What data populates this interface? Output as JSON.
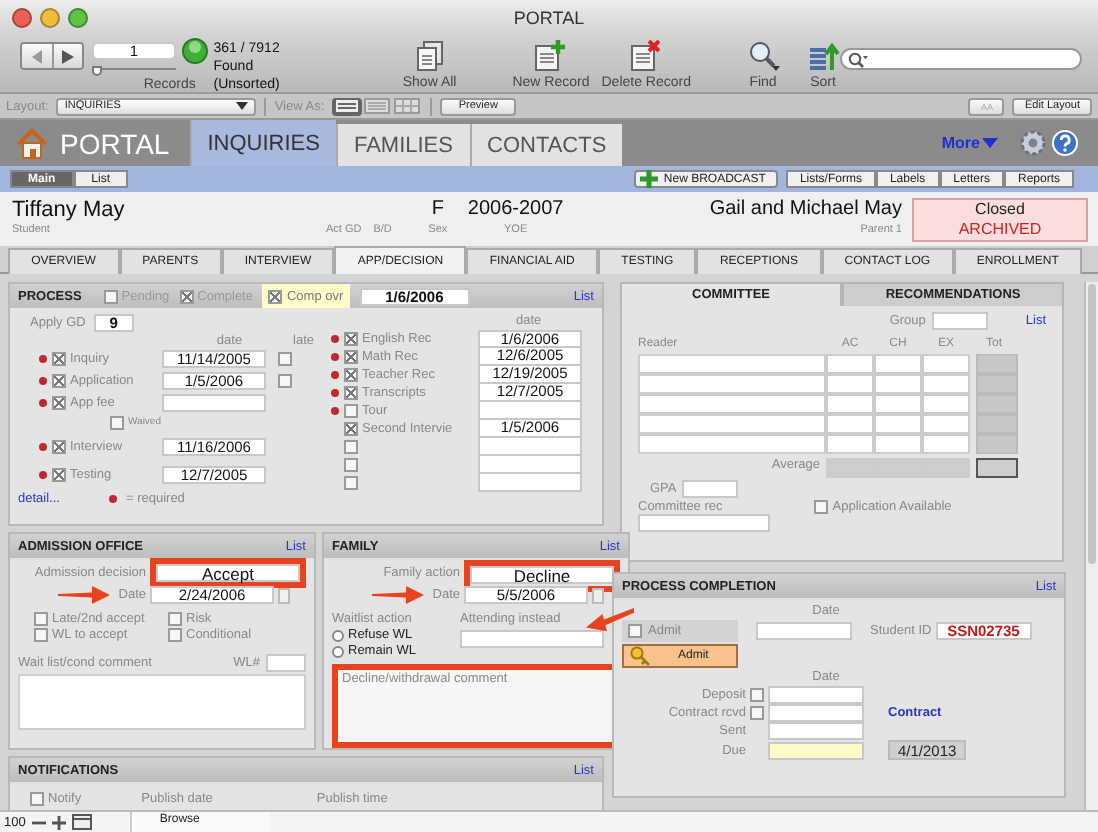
{
  "window": {
    "title": "PORTAL"
  },
  "toolbar": {
    "record_number": "1",
    "record_slider": {
      "level": 0
    },
    "record_count": "361 / 7912",
    "found_status": "Found (Unsorted)",
    "records_label": "Records",
    "actions": [
      {
        "kind": "show_all",
        "label": "Show All"
      },
      {
        "kind": "new",
        "label": "New Record"
      },
      {
        "kind": "delete",
        "label": "Delete Record"
      },
      {
        "kind": "find",
        "label": "Find"
      },
      {
        "kind": "sort",
        "label": "Sort"
      }
    ]
  },
  "layout_bar": {
    "layout_label": "Layout:",
    "layout": "INQUIRIES",
    "view_as_label": "View As:",
    "view_modes": [
      {
        "kind": "form",
        "selected": true
      },
      {
        "kind": "list",
        "selected": false
      },
      {
        "kind": "table",
        "selected": false
      }
    ],
    "preview": "Preview",
    "text_size": "AA",
    "edit_layout": "Edit Layout"
  },
  "app_header": {
    "logo": "PORTAL",
    "tabs": [
      {
        "label": "INQUIRIES",
        "selected": true
      },
      {
        "label": "FAMILIES",
        "selected": false
      },
      {
        "label": "CONTACTS",
        "selected": false
      }
    ],
    "more": "More"
  },
  "sub_bar": {
    "views": [
      {
        "label": "Main",
        "selected": true
      },
      {
        "label": "List",
        "selected": false
      }
    ],
    "broadcast": "New BROADCAST",
    "buttons": [
      "Lists/Forms",
      "Labels",
      "Letters",
      "Reports"
    ]
  },
  "student": {
    "name": "Tiffany May",
    "name_label": "Student",
    "act_gd_label": "Act GD",
    "bd_label": "B/D",
    "sex": "F",
    "sex_label": "Sex",
    "yoe": "2006-2007",
    "yoe_label": "YOE",
    "parent": "Gail and Michael May",
    "parent_label": "Parent 1",
    "status": "Closed",
    "archive": "ARCHIVED"
  },
  "record_tabs": [
    {
      "label": "OVERVIEW",
      "selected": false
    },
    {
      "label": "PARENTS",
      "selected": false
    },
    {
      "label": "INTERVIEW",
      "selected": false
    },
    {
      "label": "APP/DECISION",
      "selected": true
    },
    {
      "label": "FINANCIAL AID",
      "selected": false
    },
    {
      "label": "TESTING",
      "selected": false
    },
    {
      "label": "RECEPTIONS",
      "selected": false
    },
    {
      "label": "CONTACT LOG",
      "selected": false
    },
    {
      "label": "ENROLLMENT",
      "selected": false
    }
  ],
  "process": {
    "title": "PROCESS",
    "flags": [
      {
        "label": "Pending",
        "checked": false
      },
      {
        "label": "Complete",
        "checked": true
      }
    ],
    "override": {
      "label": "Comp ovr",
      "checked": true,
      "date": "1/6/2006"
    },
    "list_link": "List",
    "apply_gd_label": "Apply GD",
    "apply_gd": "9",
    "date_header": "date",
    "late_header": "late",
    "steps": [
      {
        "kind": "late",
        "label": "Inquiry",
        "required": true,
        "checked": true,
        "date": "11/14/2005",
        "late": false
      },
      {
        "kind": "late",
        "label": "Application",
        "required": true,
        "checked": true,
        "date": "1/5/2006",
        "late": false
      },
      {
        "kind": "fee",
        "label": "App fee",
        "required": true,
        "checked": true,
        "waived_label": "Waived",
        "waived": false
      },
      {
        "kind": "plain",
        "label": "Interview",
        "required": true,
        "checked": true,
        "date": "11/16/2006"
      },
      {
        "kind": "plain",
        "label": "Testing",
        "required": true,
        "checked": true,
        "date": "12/7/2005"
      }
    ],
    "rec_date_header": "date",
    "recs": [
      {
        "label": "English Rec",
        "required": true,
        "checked": true,
        "date": "1/6/2006"
      },
      {
        "label": "Math Rec",
        "required": true,
        "checked": true,
        "date": "12/6/2005"
      },
      {
        "label": "Teacher Rec",
        "required": true,
        "checked": true,
        "date": "12/19/2005"
      },
      {
        "label": "Transcripts",
        "required": true,
        "checked": true,
        "date": "12/7/2005"
      },
      {
        "label": "Tour",
        "required": true,
        "checked": false
      },
      {
        "label": "Second Intervie",
        "required": false,
        "checked": true,
        "date": "1/5/2006"
      },
      {
        "required": false,
        "checked": false
      },
      {
        "required": false,
        "checked": false
      },
      {
        "required": false,
        "checked": false
      }
    ],
    "detail_link": "detail...",
    "required_legend": "= required"
  },
  "committee": {
    "tabs": [
      {
        "label": "COMMITTEE",
        "selected": true
      },
      {
        "label": "RECOMMENDATIONS",
        "selected": false
      }
    ],
    "group_label": "Group",
    "list_link": "List",
    "columns": [
      "Reader",
      "AC",
      "CH",
      "EX",
      "Tot"
    ],
    "average_label": "Average",
    "gpa_label": "GPA",
    "committee_rec_label": "Committee rec",
    "application_available": {
      "label": "Application Available",
      "checked": false
    }
  },
  "admission_office": {
    "title": "ADMISSION OFFICE",
    "list_link": "List",
    "decision_label": "Admission decision",
    "decision": "Accept",
    "decision_highlighted": true,
    "date_label": "Date",
    "date": "2/24/2006",
    "date_arrow": true,
    "options": [
      {
        "label": "Late/2nd accept",
        "checked": false
      },
      {
        "label": "Risk",
        "checked": false
      },
      {
        "label": "WL to accept",
        "checked": false
      },
      {
        "label": "Conditional",
        "checked": false
      }
    ],
    "comment_label": "Wait list/cond comment",
    "wl_label": "WL#"
  },
  "family": {
    "title": "FAMILY",
    "list_link": "List",
    "action_label": "Family action",
    "action": "Decline",
    "action_highlighted": true,
    "date_label": "Date",
    "date": "5/5/2006",
    "date_arrow": true,
    "waitlist_label": "Waitlist action",
    "waitlist_options": [
      {
        "label": "Refuse WL",
        "selected": false
      },
      {
        "label": "Remain WL",
        "selected": false
      }
    ],
    "attending_label": "Attending instead",
    "attending_arrow": true,
    "comment_label": "Decline/withdrawal comment",
    "comment_highlighted": true
  },
  "notifications": {
    "title": "NOTIFICATIONS",
    "list_link": "List",
    "notify": {
      "label": "Notify",
      "checked": false
    },
    "publish_date_label": "Publish date",
    "publish_time_label": "Publish time"
  },
  "process_completion": {
    "title": "PROCESS COMPLETION",
    "list_link": "List",
    "date_label": "Date",
    "admit": {
      "label": "Admit",
      "checked": false
    },
    "admit_button": "Admit",
    "student_id_label": "Student ID",
    "student_id": "SSN02735",
    "deposit_date_label": "Date",
    "deposit": {
      "label": "Deposit",
      "checked": false
    },
    "contract": {
      "label": "Contract rcvd",
      "checked": false
    },
    "contract_link": "Contract",
    "sent_label": "Sent",
    "due_label": "Due",
    "due_date": "4/1/2013"
  },
  "status_bar": {
    "zoom": "100",
    "mode": "Browse"
  }
}
